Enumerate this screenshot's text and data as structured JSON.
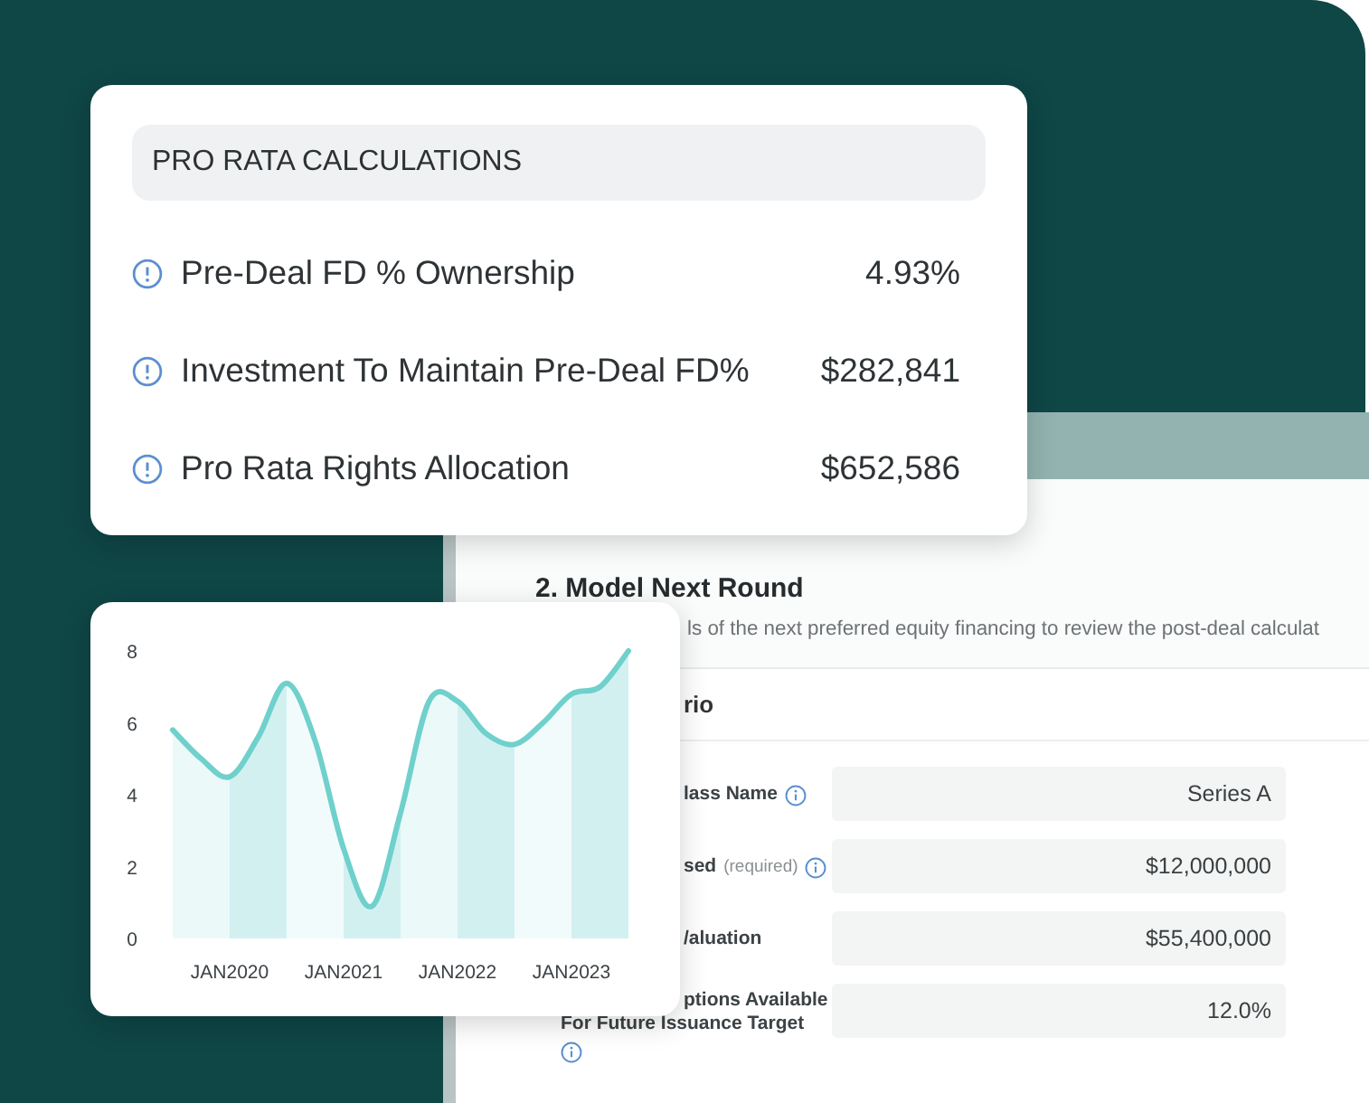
{
  "pro_rata_card": {
    "title": "PRO RATA CALCULATIONS",
    "rows": [
      {
        "label": "Pre-Deal FD % Ownership",
        "value": "4.93%"
      },
      {
        "label": "Investment To Maintain Pre-Deal FD%",
        "value": "$282,841"
      },
      {
        "label": "Pro Rata Rights Allocation",
        "value": "$652,586"
      }
    ]
  },
  "chart_card": {
    "chart_data": {
      "type": "line",
      "categories": [
        null,
        null,
        "JAN2020",
        null,
        null,
        null,
        "JAN2021",
        null,
        null,
        null,
        "JAN2022",
        null,
        null,
        null,
        "JAN2023",
        null,
        null
      ],
      "series": [
        {
          "color": "#6fd0cc",
          "values": [
            5.8,
            5,
            4.5,
            5.6,
            7.1,
            5.5,
            2.5,
            0.9,
            3.5,
            6.6,
            6.6,
            5.7,
            5.4,
            6,
            6.8,
            7,
            8
          ]
        }
      ],
      "ylim": [
        0,
        8
      ],
      "yticks": [
        0,
        2,
        4,
        6,
        8
      ]
    }
  },
  "app_window": {
    "heading": "2. Model Next Round",
    "description": "ls of the next preferred equity financing to review the post-deal calculat",
    "section_title": "rio",
    "fields": [
      {
        "label_lines": [
          "lass Name"
        ],
        "info": true,
        "value": "Series A"
      },
      {
        "label_lines": [
          "sed"
        ],
        "note": "(required)",
        "info": true,
        "value": "$12,000,000"
      },
      {
        "label_lines": [
          "/aluation"
        ],
        "info": false,
        "value": "$55,400,000"
      },
      {
        "label_lines": [
          "ptions Available",
          "For Future Issuance Target"
        ],
        "info": true,
        "value": "12.0%"
      }
    ]
  }
}
